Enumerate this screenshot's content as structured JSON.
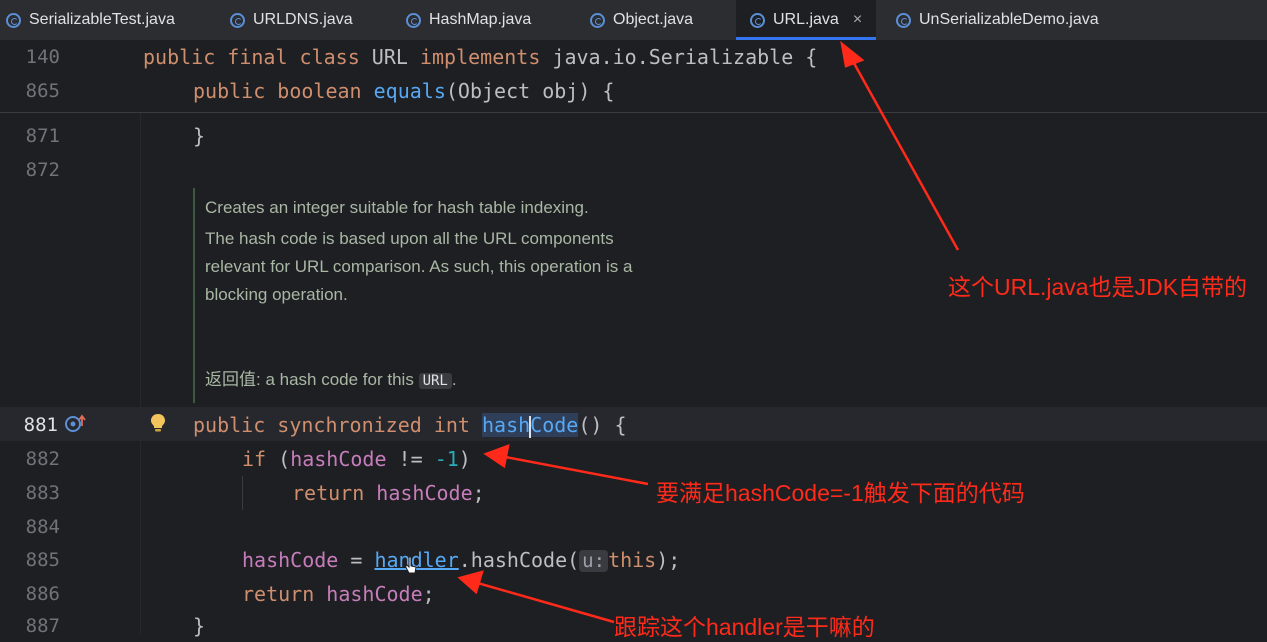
{
  "tabs": [
    {
      "label": "SerializableTest.java",
      "active": false
    },
    {
      "label": "URLDNS.java",
      "active": false
    },
    {
      "label": "HashMap.java",
      "active": false
    },
    {
      "label": "Object.java",
      "active": false
    },
    {
      "label": "URL.java",
      "active": true
    },
    {
      "label": "UnSerializableDemo.java",
      "active": false
    }
  ],
  "tab_close_glyph": "×",
  "sticky": {
    "line1_no": "140",
    "line1": {
      "mod": "public final class",
      "name": " URL ",
      "impl": "implements",
      "rest": " java.io.Serializable {"
    },
    "line2_no": "865",
    "line2": {
      "mod": "public boolean",
      "fn": "equals",
      "rest": "(Object obj) {"
    }
  },
  "lines": {
    "l871": {
      "no": "871",
      "text": "}"
    },
    "l872": {
      "no": "872"
    },
    "l881": {
      "no": "881",
      "kw": "public synchronized int",
      "fn1": "hash",
      "fn2": "Code",
      "rest": "() {"
    },
    "l882": {
      "no": "882",
      "kw": "if",
      "open": " (",
      "fld": "hashCode",
      "op": " != ",
      "num": "-1",
      "close": ")"
    },
    "l883": {
      "no": "883",
      "kw": "return",
      "fld": "hashCode",
      "semi": ";"
    },
    "l884": {
      "no": "884"
    },
    "l885": {
      "no": "885",
      "fld": "hashCode",
      "eq": " = ",
      "fld2": "handler",
      "call": ".hashCode(",
      "hint": "u:",
      "kw": "this",
      "end": ");"
    },
    "l886": {
      "no": "886",
      "kw": "return",
      "fld": "hashCode",
      "semi": ";"
    },
    "l887": {
      "no": "887",
      "text": "}"
    }
  },
  "doc": {
    "p1": "Creates an integer suitable for hash table indexing.",
    "p2": "The hash code is based upon all the URL components",
    "p3": "relevant for URL comparison. As such, this operation is a",
    "p4": "blocking operation.",
    "ret_label": "返回值:",
    "ret_text": " a hash code for this ",
    "ret_tag": "URL",
    "ret_end": "."
  },
  "annotations": {
    "a1": "这个URL.java也是JDK自带的",
    "a2": "要满足hashCode=-1触发下面的代码",
    "a3": "跟踪这个handler是干嘛的"
  },
  "colors": {
    "annotation": "#ff2a1a",
    "accent": "#3574f0",
    "keyword": "#cf8e6d",
    "function": "#56a8f5",
    "field": "#c77dbb",
    "number": "#2aacb8"
  },
  "icons": {
    "tab": "java-class-icon",
    "gutter": "override-method-icon",
    "bulb": "intention-bulb-icon"
  }
}
